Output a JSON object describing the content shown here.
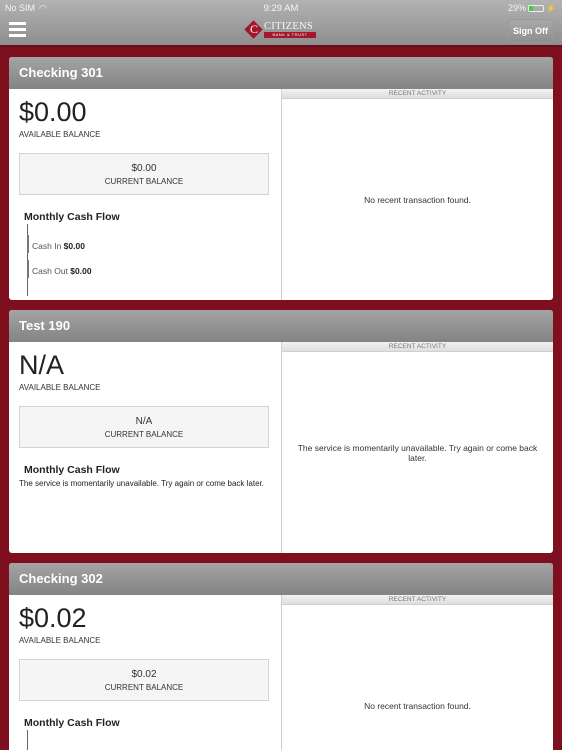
{
  "status_bar": {
    "carrier": "No SIM",
    "time": "9:29 AM",
    "battery_percent": "29%",
    "battery_level": 0.29
  },
  "header": {
    "brand_name": "CITIZENS",
    "brand_sub": "BANK & TRUST",
    "logo_letter": "C",
    "sign_off_label": "Sign Off"
  },
  "colors": {
    "brand_red": "#7e0f1f",
    "accent_red": "#a3162c"
  },
  "accounts": [
    {
      "name": "Checking 301",
      "available_balance": "$0.00",
      "available_label": "AVAILABLE BALANCE",
      "current_balance": "$0.00",
      "current_label": "CURRENT BALANCE",
      "cash_flow_title": "Monthly Cash Flow",
      "cash_in_label": "Cash In",
      "cash_in_value": "$0.00",
      "cash_out_label": "Cash Out",
      "cash_out_value": "$0.00",
      "recent_activity_label": "RECENT ACTIVITY",
      "recent_activity_message": "No recent transaction found."
    },
    {
      "name": "Test 190",
      "available_balance": "N/A",
      "available_label": "AVAILABLE BALANCE",
      "current_balance": "N/A",
      "current_label": "CURRENT BALANCE",
      "cash_flow_title": "Monthly Cash Flow",
      "cash_flow_message": "The service is momentarily unavailable. Try again or come back later.",
      "recent_activity_label": "RECENT ACTIVITY",
      "recent_activity_message": "The service is momentarily unavailable. Try again or come back later."
    },
    {
      "name": "Checking 302",
      "available_balance": "$0.02",
      "available_label": "AVAILABLE BALANCE",
      "current_balance": "$0.02",
      "current_label": "CURRENT BALANCE",
      "cash_flow_title": "Monthly Cash Flow",
      "recent_activity_label": "RECENT ACTIVITY",
      "recent_activity_message": "No recent transaction found."
    }
  ]
}
